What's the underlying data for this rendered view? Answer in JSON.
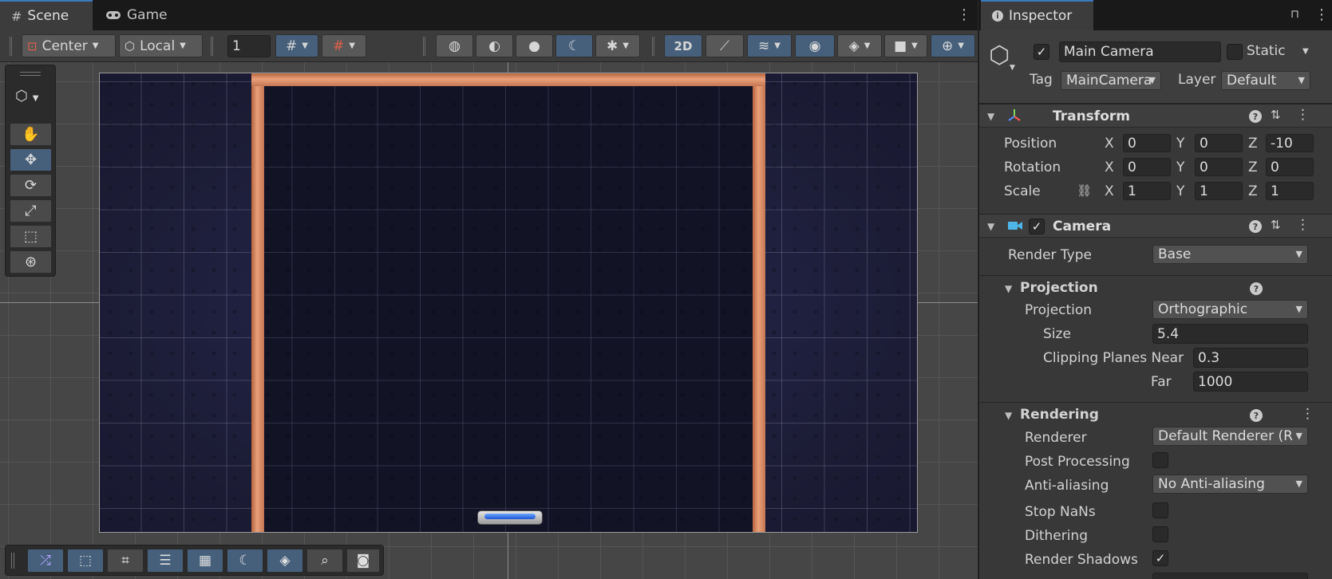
{
  "scene_panel": {
    "tabs": [
      {
        "label": "Scene",
        "icon": "grid-icon"
      },
      {
        "label": "Game",
        "icon": "gamepad-icon"
      }
    ],
    "toolbar": {
      "pivot_mode": "Center",
      "pivot_rotation": "Local",
      "grid_snap_increment": "1",
      "mode_2d": "2D"
    }
  },
  "inspector": {
    "tab_label": "Inspector",
    "object": {
      "active": true,
      "name": "Main Camera",
      "static_label": "Static",
      "static": false,
      "tag_label": "Tag",
      "tag": "MainCamera",
      "layer_label": "Layer",
      "layer": "Default"
    },
    "transform": {
      "title": "Transform",
      "position_label": "Position",
      "rotation_label": "Rotation",
      "scale_label": "Scale",
      "position": {
        "x": "0",
        "y": "0",
        "z": "-10"
      },
      "rotation": {
        "x": "0",
        "y": "0",
        "z": "0"
      },
      "scale": {
        "x": "1",
        "y": "1",
        "z": "1"
      },
      "axis_x": "X",
      "axis_y": "Y",
      "axis_z": "Z"
    },
    "camera": {
      "title": "Camera",
      "enabled": true,
      "render_type_label": "Render Type",
      "render_type": "Base",
      "projection_section": "Projection",
      "projection_label": "Projection",
      "projection": "Orthographic",
      "size_label": "Size",
      "size": "5.4",
      "clipping_near_label": "Clipping Planes Near",
      "clipping_near": "0.3",
      "clipping_far_label": "Far",
      "clipping_far": "1000",
      "rendering_section": "Rendering",
      "renderer_label": "Renderer",
      "renderer": "Default Renderer (R",
      "post_processing_label": "Post Processing",
      "post_processing": false,
      "anti_aliasing_label": "Anti-aliasing",
      "anti_aliasing": "No Anti-aliasing",
      "stop_nans_label": "Stop NaNs",
      "stop_nans": false,
      "dithering_label": "Dithering",
      "dithering": false,
      "render_shadows_label": "Render Shadows",
      "render_shadows": true
    }
  },
  "colors": {
    "accent_blue": "#46607c",
    "wall_copper": "#e9a07a",
    "paddle_blue": "#1f56d6",
    "game_background": "#1c1c36"
  }
}
